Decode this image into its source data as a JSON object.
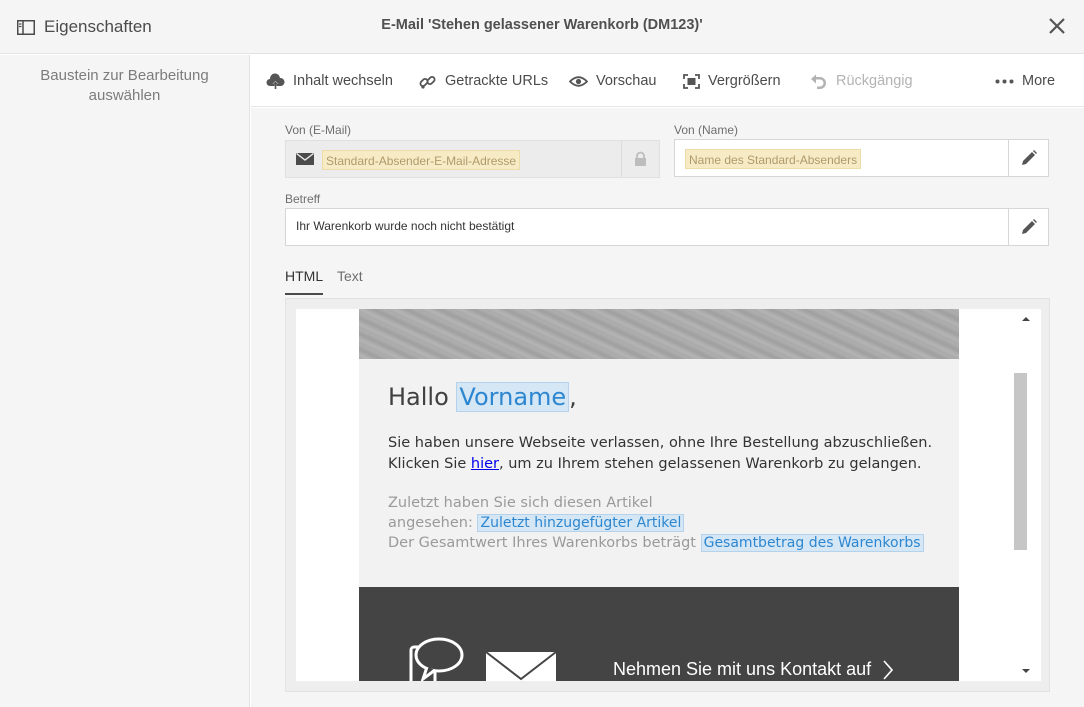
{
  "header": {
    "properties_label": "Eigenschaften",
    "title": "E-Mail 'Stehen gelassener Warenkorb (DM123)'"
  },
  "left_panel": {
    "hint": "Baustein zur Bearbeitung auswählen"
  },
  "toolbar": {
    "change_content": "Inhalt wechseln",
    "tracked_urls": "Getrackte URLs",
    "preview": "Vorschau",
    "enlarge": "Vergrößern",
    "undo": "Rückgängig",
    "more": "More"
  },
  "form": {
    "from_email_label": "Von (E-Mail)",
    "from_email_placeholder": "Standard-Absender-E-Mail-Adresse",
    "from_name_label": "Von (Name)",
    "from_name_placeholder": "Name des Standard-Absenders",
    "subject_label": "Betreff",
    "subject_value": "Ihr Warenkorb wurde noch nicht bestätigt"
  },
  "tabs": [
    "HTML",
    "Text"
  ],
  "email": {
    "greeting": "Hallo",
    "firstname_token": "Vorname",
    "greeting_comma": ",",
    "line1": "Sie haben unsere Webseite verlassen, ohne Ihre Bestellung abzuschließen.",
    "line2_before": "Klicken Sie ",
    "line2_link": "hier",
    "line2_after": ", um zu Ihrem stehen gelassenen Warenkorb zu gelangen.",
    "viewed_line1": "Zuletzt haben Sie sich diesen Artikel",
    "viewed_line2": "angesehen: ",
    "last_item_token": "Zuletzt hinzugefügter Artikel",
    "total_text": "Der Gesamtwert Ihres Warenkorbs beträgt ",
    "total_token": "Gesamtbetrag des Warenkorbs",
    "contact": "Nehmen Sie mit uns Kontakt auf"
  }
}
